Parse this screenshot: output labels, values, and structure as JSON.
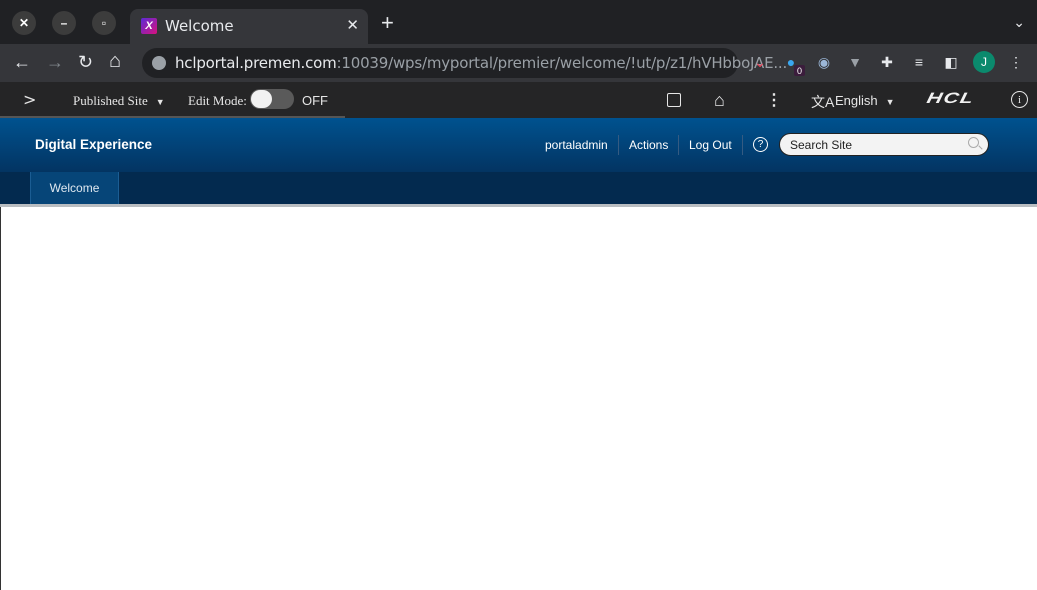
{
  "browser": {
    "window_controls": {
      "close": "✕",
      "minimize": "–",
      "maximize": "▫"
    },
    "tab": {
      "title": "Welcome",
      "favicon": "X",
      "close": "✕"
    },
    "new_tab": "+",
    "tab_menu": "⌄",
    "nav": {
      "back": "←",
      "forward": "→",
      "reload": "↻",
      "home": "⌂"
    },
    "url": {
      "host": "hclportal.premen.com",
      "rest": ":10039/wps/myportal/premier/welcome/!ut/p/z1/hVHbboJAE..."
    },
    "extensions": [
      {
        "name": "pocket-icon",
        "glyph": "⌄"
      },
      {
        "name": "ghostery-icon",
        "glyph": "●",
        "badge": "0"
      },
      {
        "name": "circle-extension-icon",
        "glyph": "◉"
      },
      {
        "name": "v-extension-icon",
        "glyph": "▼"
      },
      {
        "name": "puzzle-icon",
        "glyph": "✚"
      },
      {
        "name": "media-queue-icon",
        "glyph": "≡"
      },
      {
        "name": "side-panel-icon",
        "glyph": "◧"
      }
    ],
    "profile_initial": "J",
    "menu": "⋮"
  },
  "dx_toolbar": {
    "expand": ">",
    "site_selector": "Published Site",
    "edit_mode_label": "Edit Mode:",
    "edit_mode_state": "OFF",
    "edit_mode_on": false,
    "language": "English",
    "brand": "HCL"
  },
  "portal": {
    "brand": "Digital Experience",
    "links": [
      "portaladmin",
      "Actions",
      "Log Out"
    ],
    "help": "?",
    "search_placeholder": "Search Site",
    "nav_tabs": [
      "Welcome"
    ]
  }
}
